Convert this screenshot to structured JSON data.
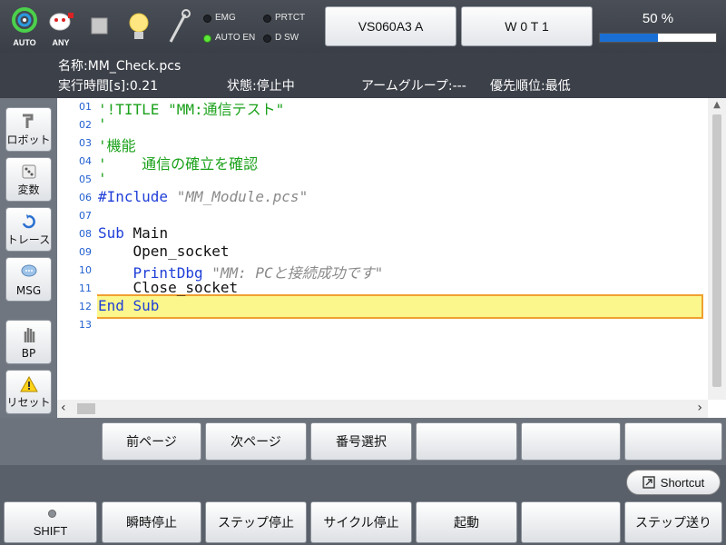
{
  "topbar": {
    "auto_label": "AUTO",
    "any_label": "ANY",
    "indicators": {
      "emg": "EMG",
      "prtct": "PRTCT",
      "auto_en": "AUTO EN",
      "dsw": "D SW"
    },
    "robot_model": "VS060A3 A",
    "tool": "W 0 T 1",
    "speed_label": "50 %",
    "speed_percent": 50
  },
  "info": {
    "name": "名称:MM_Check.pcs",
    "exec_time": "実行時間[s]:0.21",
    "status": "状態:停止中",
    "arm_group": "アームグループ:---",
    "priority": "優先順位:最低"
  },
  "side_buttons": {
    "robot": "ロボット",
    "variable": "変数",
    "trace": "トレース",
    "msg": "MSG",
    "bp": "BP",
    "reset": "リセット"
  },
  "code": {
    "line_numbers": [
      "01",
      "02",
      "03",
      "04",
      "05",
      "06",
      "07",
      "08",
      "09",
      "10",
      "11",
      "12",
      "13"
    ],
    "l01_pre": "'!TITLE ",
    "l01_str": "\"MM:通信テスト\"",
    "l02": "'",
    "l03": "'機能",
    "l04": "'    通信の確立を確認",
    "l05": "'",
    "l06_kw": "#Include ",
    "l06_str": "\"MM_Module.pcs\"",
    "l08_kw": "Sub",
    "l08_rest": " Main",
    "l09": "    Open_socket",
    "l10_indent": "    ",
    "l10_kw": "PrintDbg",
    "l10_str": " \"MM: PCと接続成功です\"",
    "l11": "    Close_socket",
    "l12": "End Sub",
    "current_line": 12
  },
  "func_buttons": [
    "前ページ",
    "次ページ",
    "番号選択",
    "",
    "",
    ""
  ],
  "shortcut_label": "Shortcut",
  "bottom_buttons": {
    "shift": "SHIFT",
    "instant_stop": "瞬時停止",
    "step_stop": "ステップ停止",
    "cycle_stop": "サイクル停止",
    "start": "起動",
    "blank": "",
    "step_forward": "ステップ送り"
  },
  "colors": {
    "keyword": "#1f3fd8",
    "comment": "#1aa11a",
    "string": "#8a8a8a",
    "current_line_bg": "#fcf78c",
    "current_line_border": "#f0a030",
    "speed_fill": "#1a6fd4"
  }
}
